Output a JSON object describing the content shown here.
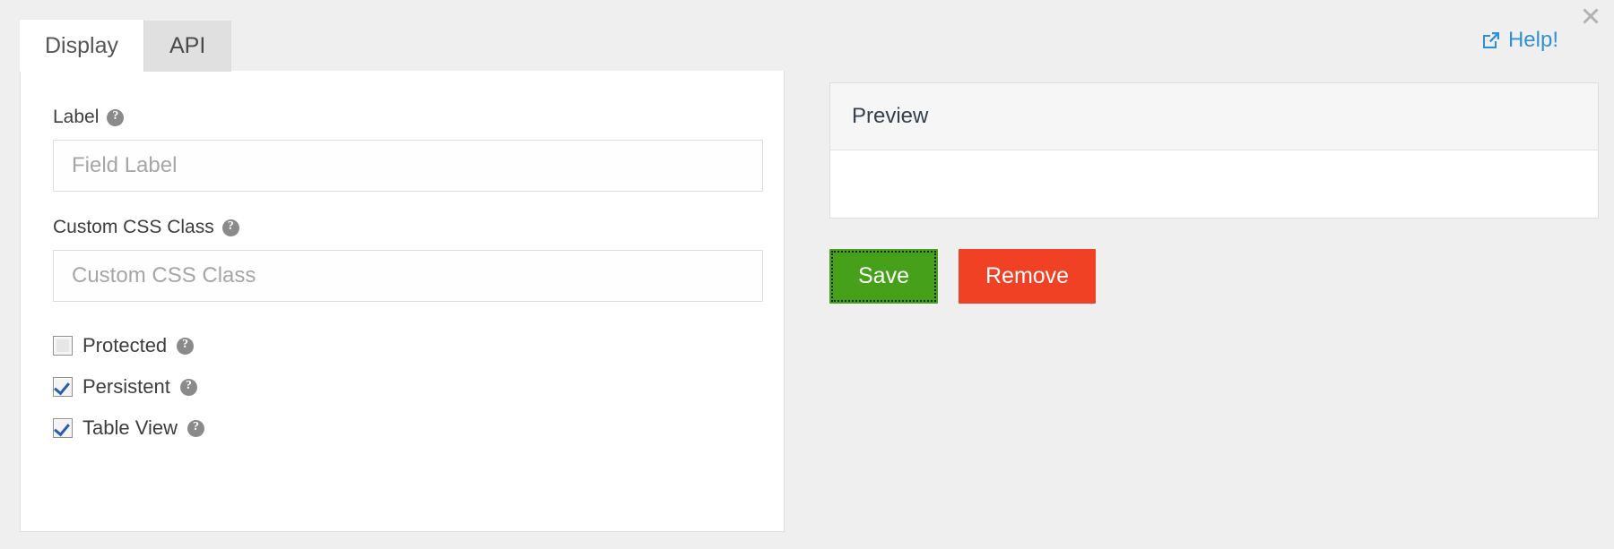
{
  "window": {
    "close_icon": "close-icon",
    "background_color": "#efefef"
  },
  "help": {
    "label": "Help!",
    "icon": "external-link-icon",
    "color": "#3091d1"
  },
  "tabs": [
    {
      "label": "Display",
      "active": true
    },
    {
      "label": "API",
      "active": false
    }
  ],
  "form": {
    "fields": [
      {
        "label": "Label",
        "help_icon": "question-mark-circle-icon",
        "value": "",
        "placeholder": "Field Label"
      },
      {
        "label": "Custom CSS Class",
        "help_icon": "question-mark-circle-icon",
        "value": "",
        "placeholder": "Custom CSS Class"
      }
    ],
    "checkboxes": [
      {
        "label": "Protected",
        "checked": false,
        "help_icon": "question-mark-circle-icon"
      },
      {
        "label": "Persistent",
        "checked": true,
        "help_icon": "question-mark-circle-icon"
      },
      {
        "label": "Table View",
        "checked": true,
        "help_icon": "question-mark-circle-icon"
      }
    ]
  },
  "preview": {
    "title": "Preview",
    "body_text": ""
  },
  "actions": {
    "save_label": "Save",
    "save_color": "#46a01a",
    "remove_label": "Remove",
    "remove_color": "#f04124"
  }
}
